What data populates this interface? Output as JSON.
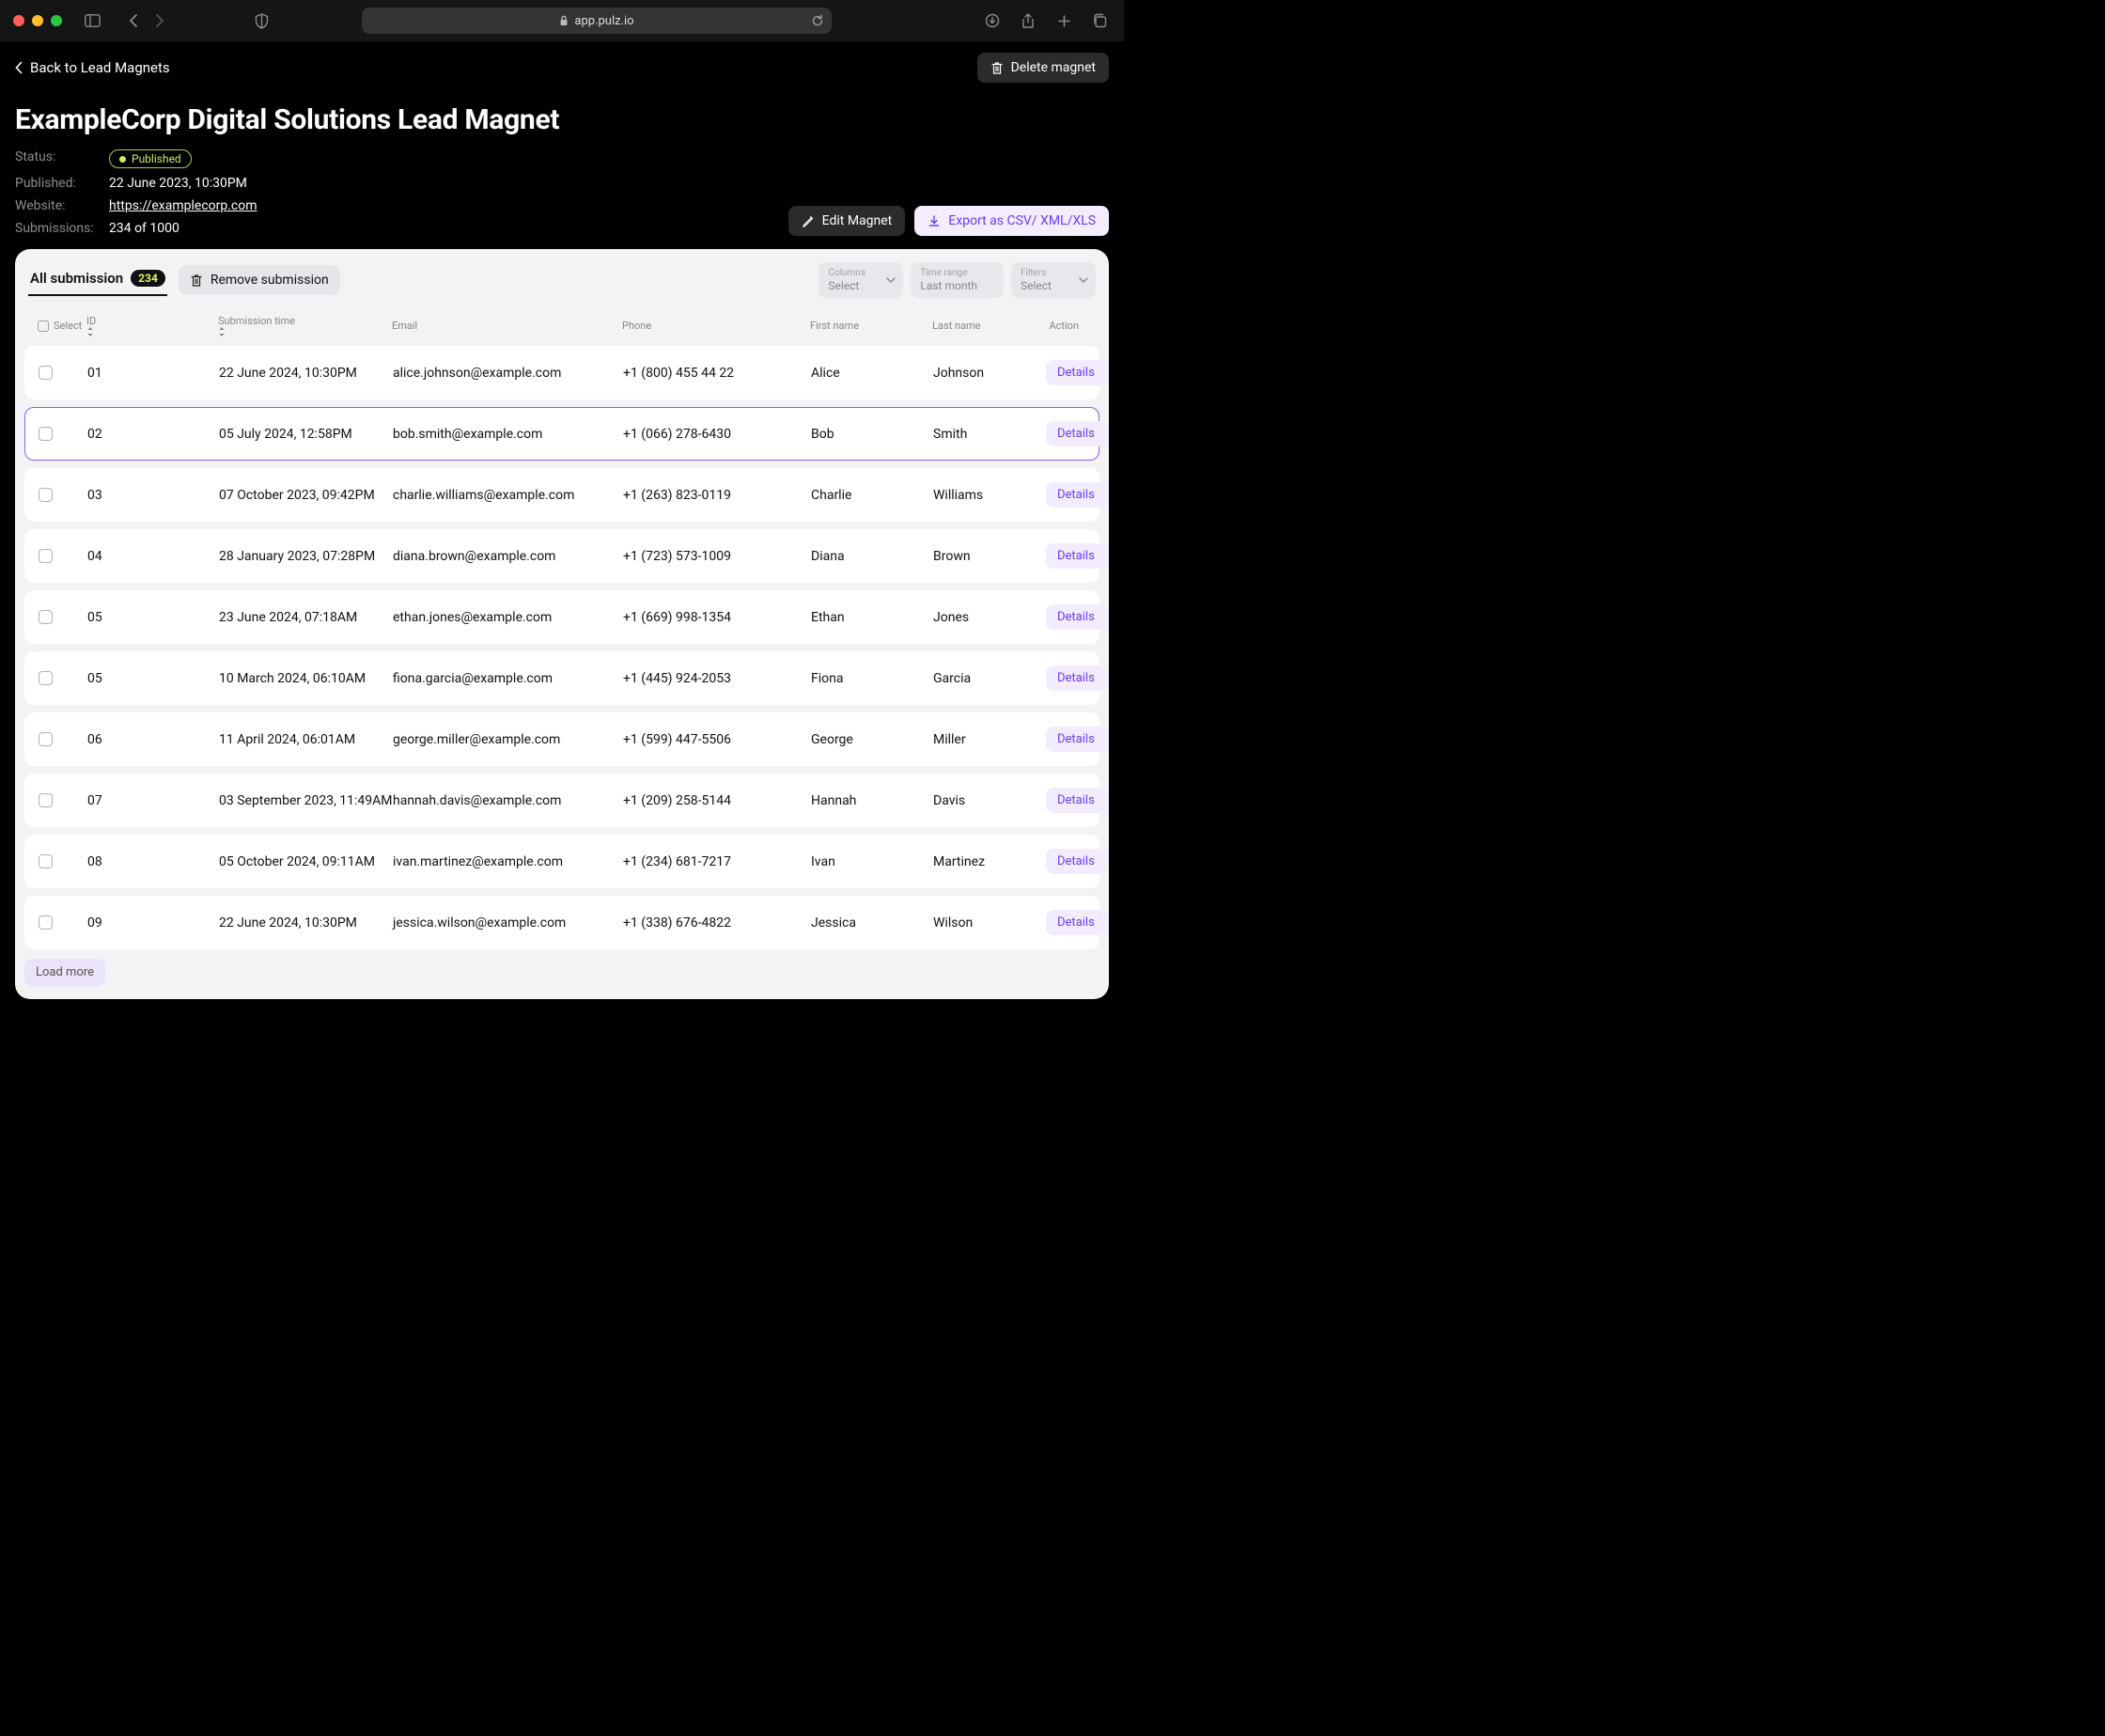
{
  "browser": {
    "url": "app.pulz.io"
  },
  "back_link": "Back to Lead Magnets",
  "delete_btn": "Delete magnet",
  "title": "ExampleCorp Digital Solutions Lead Magnet",
  "meta": {
    "status_label": "Status:",
    "status_value": "Published",
    "published_label": "Published:",
    "published_value": "22 June 2023, 10:30PM",
    "website_label": "Website:",
    "website_value": "https://examplecorp.com",
    "submissions_label": "Submissions:",
    "submissions_value": "234 of 1000"
  },
  "edit_btn": "Edit Magnet",
  "export_btn": "Export as CSV/ XML/XLS",
  "tab_all": "All submission",
  "tab_count": "234",
  "remove_btn": "Remove submission",
  "filters": {
    "columns_label": "Columns",
    "columns_value": "Select",
    "timerange_label": "Time range",
    "timerange_value": "Last month",
    "filters_label": "Filters",
    "filters_value": "Select"
  },
  "columns": {
    "select": "Select",
    "id": "ID",
    "submission_time": "Submission time",
    "email": "Email",
    "phone": "Phone",
    "first_name": "First name",
    "last_name": "Last name",
    "action": "Action"
  },
  "details_label": "Details",
  "load_more": "Load more",
  "rows": [
    {
      "id": "01",
      "time": "22 June 2024, 10:30PM",
      "email": "alice.johnson@example.com",
      "phone": "+1 (800) 455 44 22",
      "first": "Alice",
      "last": "Johnson",
      "selected": false
    },
    {
      "id": "02",
      "time": "05 July 2024, 12:58PM",
      "email": "bob.smith@example.com",
      "phone": "+1 (066) 278-6430",
      "first": "Bob",
      "last": "Smith",
      "selected": true
    },
    {
      "id": "03",
      "time": "07 October 2023, 09:42PM",
      "email": "charlie.williams@example.com",
      "phone": "+1 (263) 823-0119",
      "first": "Charlie",
      "last": "Williams",
      "selected": false
    },
    {
      "id": "04",
      "time": "28 January 2023, 07:28PM",
      "email": "diana.brown@example.com",
      "phone": "+1 (723) 573-1009",
      "first": "Diana",
      "last": "Brown",
      "selected": false
    },
    {
      "id": "05",
      "time": "23 June 2024, 07:18AM",
      "email": "ethan.jones@example.com",
      "phone": "+1 (669) 998-1354",
      "first": "Ethan",
      "last": "Jones",
      "selected": false
    },
    {
      "id": "05",
      "time": "10 March 2024, 06:10AM",
      "email": "fiona.garcia@example.com",
      "phone": "+1 (445) 924-2053",
      "first": "Fiona",
      "last": "Garcia",
      "selected": false
    },
    {
      "id": "06",
      "time": "11 April 2024, 06:01AM",
      "email": "george.miller@example.com",
      "phone": "+1 (599) 447-5506",
      "first": "George",
      "last": "Miller",
      "selected": false
    },
    {
      "id": "07",
      "time": "03 September 2023, 11:49AM",
      "email": "hannah.davis@example.com",
      "phone": "+1 (209) 258-5144",
      "first": "Hannah",
      "last": "Davis",
      "selected": false
    },
    {
      "id": "08",
      "time": "05 October 2024, 09:11AM",
      "email": "ivan.martinez@example.com",
      "phone": "+1 (234) 681-7217",
      "first": "Ivan",
      "last": "Martinez",
      "selected": false
    },
    {
      "id": "09",
      "time": "22 June 2024, 10:30PM",
      "email": "jessica.wilson@example.com",
      "phone": "+1 (338) 676-4822",
      "first": "Jessica",
      "last": "Wilson",
      "selected": false
    }
  ]
}
